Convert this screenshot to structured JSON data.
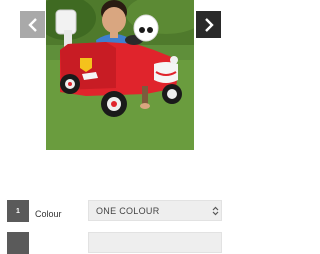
{
  "gallery": {
    "image_alt": "Child riding red fire truck ride-on toy",
    "prev_icon": "chevron-left-icon",
    "next_icon": "chevron-right-icon"
  },
  "options": [
    {
      "step": "1",
      "label": "Colour",
      "selected": "ONE COLOUR",
      "icon": "select-arrows-icon"
    },
    {
      "step": "",
      "label": "",
      "selected": "",
      "icon": "select-arrows-icon"
    }
  ],
  "colors": {
    "badge": "#5a5a5a",
    "select_bg": "#eeeeee",
    "nav_prev": "#a9a9a9",
    "nav_next": "#2a2a2a",
    "truck_red": "#e0242c"
  }
}
